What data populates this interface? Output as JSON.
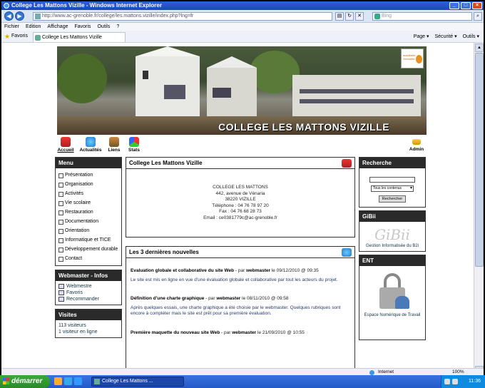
{
  "window": {
    "title": "College Les Mattons Vizille - Windows Internet Explorer",
    "minimize": "_",
    "maximize": "□",
    "close": "×"
  },
  "address_bar": {
    "url": "http://www.ac-grenoble.fr/college/les.mattons.vizille/index.php?lng=fr",
    "search_placeholder": "Bing"
  },
  "menubar": [
    "Fichier",
    "Edition",
    "Affichage",
    "Favoris",
    "Outils",
    "?"
  ],
  "favbar": {
    "favoris_label": "Favoris",
    "tab_label": "College Les Mattons Vizille",
    "commands": [
      "Page ▾",
      "Sécurité ▾",
      "Outils ▾"
    ]
  },
  "banner": {
    "title": "COLLEGE LES MATTONS VIZILLE",
    "badge_text": "académie Grenoble"
  },
  "iconbar": {
    "items": [
      {
        "label": "Accueil"
      },
      {
        "label": "Actualités"
      },
      {
        "label": "Liens"
      },
      {
        "label": "Stats"
      }
    ],
    "admin": "Admin"
  },
  "menu": {
    "title": "Menu",
    "items": [
      "Présentation",
      "Organisation",
      "Activités",
      "Vie scolaire",
      "Restauration",
      "Documentation",
      "Orientation",
      "Informatique et TICE",
      "Développement durable",
      "Contact"
    ]
  },
  "webmaster": {
    "title": "Webmaster - Infos",
    "items": [
      "Webmestre",
      "Favoris",
      "Recommander"
    ]
  },
  "visits": {
    "title": "Visites",
    "total": "113 visiteurs",
    "online": "1 visiteur en ligne"
  },
  "college_box": {
    "title": "College Les Mattons Vizille",
    "lines": [
      "COLLEGE LES MATTONS",
      "442, avenue de Vénaria",
      "38220 VIZILLE",
      "Téléphone : 04 76 78 97 20",
      "Fax : 04 76 68 28 73",
      "Email : ce0381779c@ac-grenoble.fr"
    ]
  },
  "news_box": {
    "title": "Les 3 dernières nouvelles",
    "items": [
      {
        "title": "Evaluation globale et collaborative du site Web",
        "by": " - par ",
        "author": "webmaster",
        "date": " le 09/12/2010 @ 09:35",
        "body": "Le site est mis en ligne en vue d'une évaluation globale et collaborative par tout les acteurs du projet."
      },
      {
        "title": "Définition d'une charte graphique",
        "by": " - par ",
        "author": "webmaster",
        "date": " le 08/11/2010 @ 09:58",
        "body": "Après quelques essais, une charte graphique a été choisie par le webmaster. Quelques rubriques sont encore à compléter mais le site est prêt pour sa première évaluation."
      },
      {
        "title": "Première maquette du nouveau site Web",
        "by": " - par ",
        "author": "webmaster",
        "date": " le 21/09/2010 @ 10:55",
        "body": ""
      }
    ]
  },
  "search": {
    "title": "Recherche",
    "select_value": "Tous les contenus",
    "button": "Rechercher"
  },
  "gibii": {
    "title": "GiBii",
    "logo": "GiBii",
    "caption": "Gestion Informatisée du B2i"
  },
  "ent": {
    "title": "ENT",
    "caption": "Espace Numérique de Travail"
  },
  "statusbar": {
    "zone": "Internet",
    "zoom": "100%"
  },
  "taskbar": {
    "start": "démarrer",
    "task": "College Les Mattons ...",
    "clock": "11:36"
  }
}
